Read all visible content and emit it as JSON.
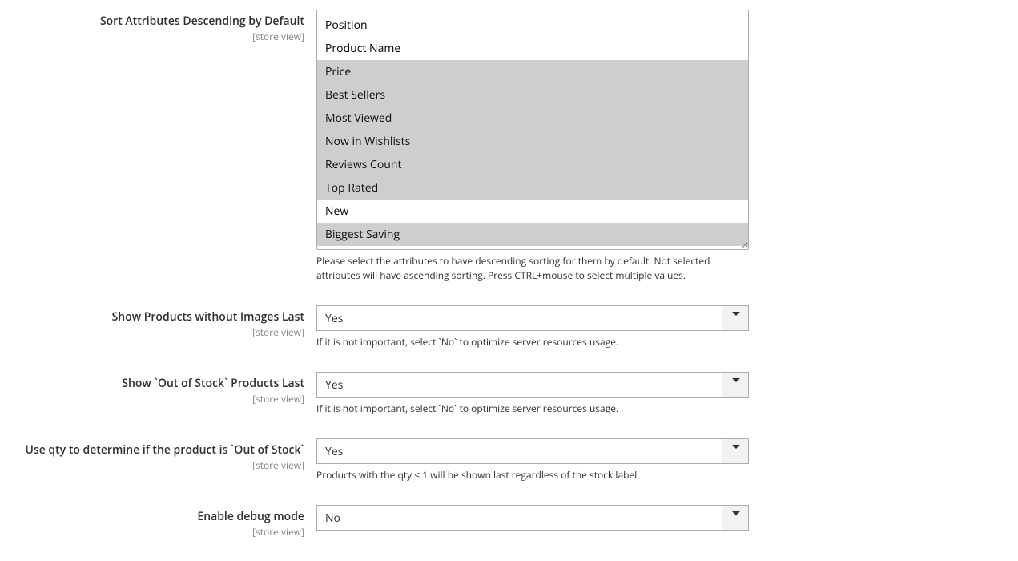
{
  "scope_label": "[store view]",
  "fields": {
    "sort_desc": {
      "label": "Sort Attributes Descending by Default",
      "options": [
        "Position",
        "Product Name",
        "Price",
        "Best Sellers",
        "Most Viewed",
        "Now in Wishlists",
        "Reviews Count",
        "Top Rated",
        "New",
        "Biggest Saving"
      ],
      "selected_indices": [
        2,
        3,
        4,
        5,
        6,
        7,
        9
      ],
      "note": "Please select the attributes to have descending sorting for them by default. Not selected attributes will have ascending sorting. Press CTRL+mouse to select multiple values."
    },
    "images_last": {
      "label": "Show Products without Images Last",
      "value": "Yes",
      "note": "If it is not important, select `No` to optimize server resources usage."
    },
    "oos_last": {
      "label": "Show `Out of Stock` Products Last",
      "value": "Yes",
      "note": "If it is not important, select `No` to optimize server resources usage."
    },
    "use_qty": {
      "label": "Use qty to determine if the product is `Out of Stock`",
      "value": "Yes",
      "note": "Products with the qty < 1 will be shown last regardless of the stock label."
    },
    "debug": {
      "label": "Enable debug mode",
      "value": "No"
    }
  },
  "yes_no_options": [
    "Yes",
    "No"
  ]
}
